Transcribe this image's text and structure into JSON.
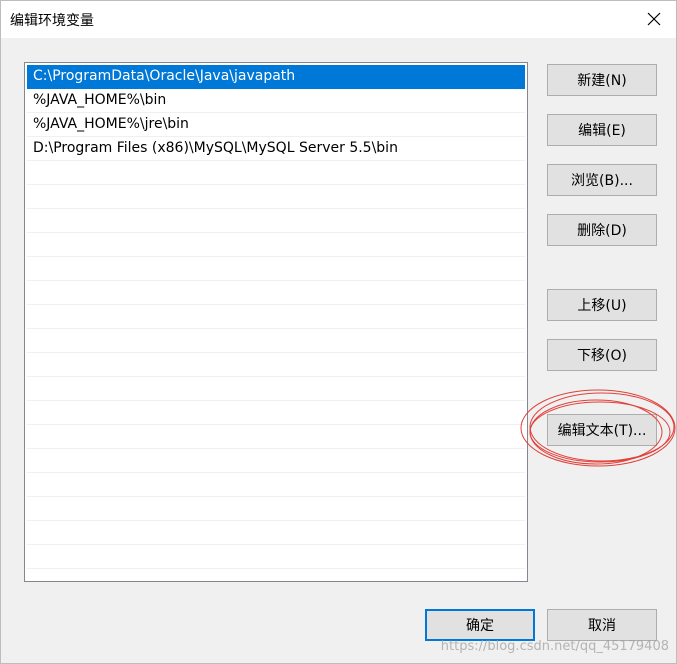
{
  "window": {
    "title": "编辑环境变量"
  },
  "paths": [
    "C:\\ProgramData\\Oracle\\Java\\javapath",
    "%JAVA_HOME%\\bin",
    "%JAVA_HOME%\\jre\\bin",
    "D:\\Program Files (x86)\\MySQL\\MySQL Server 5.5\\bin"
  ],
  "selected_index": 0,
  "buttons": {
    "new": "新建(N)",
    "edit": "编辑(E)",
    "browse": "浏览(B)...",
    "delete": "删除(D)",
    "move_up": "上移(U)",
    "move_down": "下移(O)",
    "edit_text": "编辑文本(T)...",
    "ok": "确定",
    "cancel": "取消"
  },
  "annotation_color": "#e0413a",
  "accent_color": "#0078d7",
  "watermark": "https://blog.csdn.net/qq_45179408"
}
